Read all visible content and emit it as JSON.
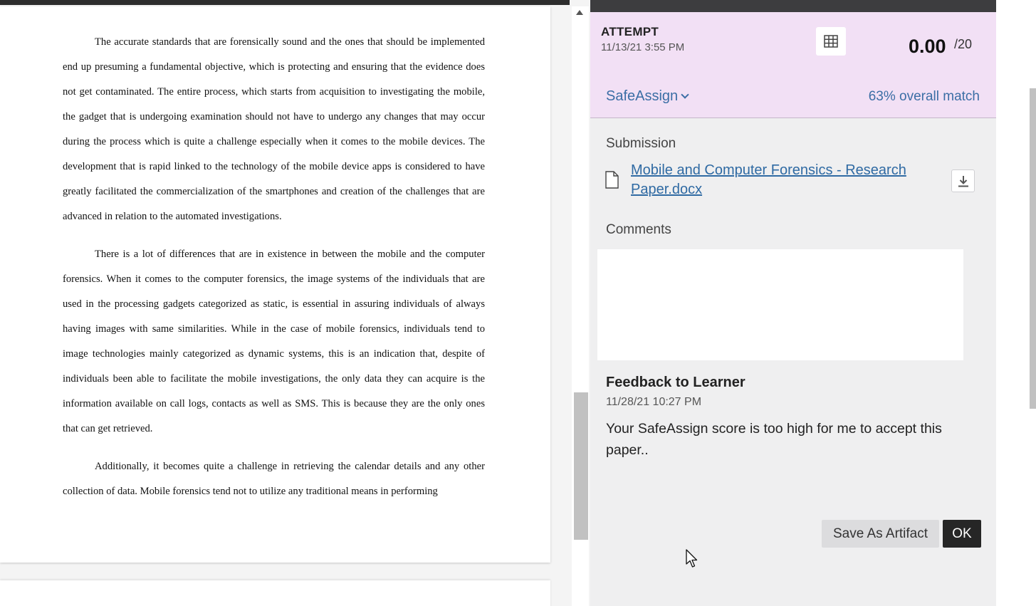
{
  "document": {
    "paragraphs": [
      "The accurate standards that are forensically sound and the ones that should be implemented end up presuming a fundamental objective, which is protecting and ensuring that the evidence does not get contaminated. The entire process, which starts from acquisition to investigating the mobile, the gadget that is undergoing examination should not have to undergo any changes that may occur during the process which is quite a challenge especially when it comes to the mobile devices. The development that is rapid linked to the technology of the mobile device apps is considered to have greatly facilitated the commercialization of the smartphones and creation of the challenges that are advanced in relation to the automated investigations.",
      "There is a lot of differences that are in existence in between the mobile and the computer forensics. When it comes to the computer forensics, the image systems of the individuals that are used in the processing gadgets categorized as static, is essential in assuring individuals of always having images with same similarities. While in the case of mobile forensics, individuals tend to image technologies mainly categorized as dynamic systems, this is an indication that, despite of individuals been able to facilitate the mobile investigations, the only data they can acquire is the information available on call logs, contacts as well as SMS. This is because they are the only ones that can get retrieved.",
      "Additionally, it becomes quite a challenge in retrieving the calendar details and any other collection of data. Mobile forensics tend not to utilize any traditional means in performing"
    ]
  },
  "attempt": {
    "label": "ATTEMPT",
    "date": "11/13/21 3:55 PM",
    "score": "0.00",
    "max_score": "/20",
    "grid_icon": "grid-icon"
  },
  "safeassign": {
    "label": "SafeAssign",
    "match": "63% overall match"
  },
  "submission": {
    "heading": "Submission",
    "file_name": "Mobile and Computer Forensics - Research Paper.docx",
    "file_icon": "document-icon",
    "download_icon": "download-icon"
  },
  "comments": {
    "heading": "Comments",
    "value": ""
  },
  "feedback": {
    "heading": "Feedback to Learner",
    "date": "11/28/21 10:27 PM",
    "text": "Your SafeAssign score is too high for me to accept this paper.."
  },
  "actions": {
    "save_artifact": "Save As Artifact",
    "ok": "OK"
  },
  "colors": {
    "attempt_header_bg": "#f2e0f5",
    "link": "#2f6aa3",
    "primary_button": "#262626"
  }
}
